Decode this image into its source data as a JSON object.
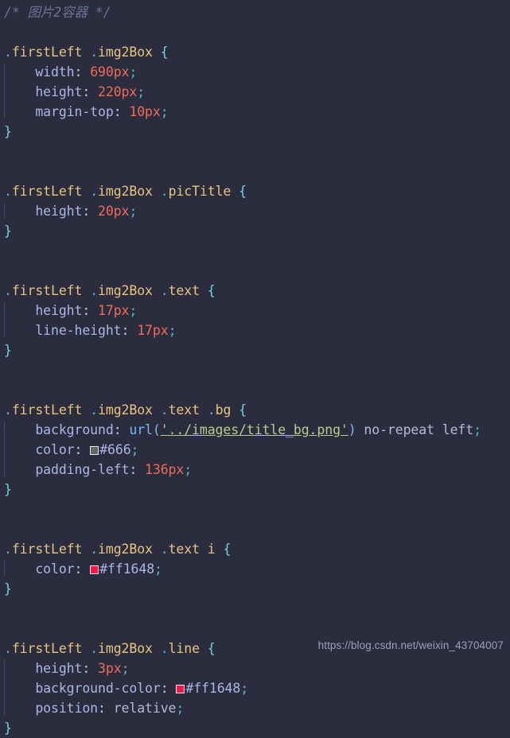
{
  "editor": {
    "theme": {
      "background": "#2b2d3e",
      "comment": "#6b7394",
      "selector": "#e8c47e",
      "property": "#a9b7e8",
      "value": "#ef6b5a",
      "brace": "#6fd3e0",
      "string": "#b7cc8e",
      "keyword": "#b3bad6",
      "indent_guide": "#474b63"
    },
    "language": "css"
  },
  "code": {
    "comment_line": "/* 图片2容器 */",
    "blocks": [
      {
        "selector": {
          "prefix_dot": ".",
          "name": "firstLeft",
          "parts": [
            ".firstLeft",
            ".img2Box"
          ],
          "open_brace": "{"
        },
        "selector_text": ".firstLeft .img2Box {",
        "declarations": [
          {
            "property": "width",
            "value": "690px"
          },
          {
            "property": "height",
            "value": "220px"
          },
          {
            "property": "margin-top",
            "value": "10px"
          }
        ],
        "close_brace": "}"
      },
      {
        "selector_text": ".firstLeft .img2Box .picTitle {",
        "declarations": [
          {
            "property": "height",
            "value": "20px"
          }
        ],
        "close_brace": "}"
      },
      {
        "selector_text": ".firstLeft .img2Box .text {",
        "declarations": [
          {
            "property": "height",
            "value": "17px"
          },
          {
            "property": "line-height",
            "value": "17px"
          }
        ],
        "close_brace": "}"
      },
      {
        "selector_text": ".firstLeft .img2Box .text .bg {",
        "declarations": [
          {
            "property": "background",
            "value": "url('../images/title_bg.png') no-repeat left"
          },
          {
            "property": "color",
            "value": "#666",
            "swatch": "#666666"
          },
          {
            "property": "padding-left",
            "value": "136px"
          }
        ],
        "close_brace": "}"
      },
      {
        "selector_text": ".firstLeft .img2Box .text i {",
        "declarations": [
          {
            "property": "color",
            "value": "#ff1648",
            "swatch": "#ff1648"
          }
        ],
        "close_brace": "}"
      },
      {
        "selector_text": ".firstLeft .img2Box .line {",
        "declarations": [
          {
            "property": "height",
            "value": "3px"
          },
          {
            "property": "background-color",
            "value": "#ff1648",
            "swatch": "#ff1648"
          },
          {
            "property": "position",
            "value": "relative"
          }
        ],
        "close_brace": "}"
      }
    ],
    "tokens": {
      "dot": ".",
      "colon": ":",
      "semicolon": ";",
      "open_brace": "{",
      "close_brace": "}",
      "url_fn": "url(",
      "url_close": ")",
      "url_string": "'../images/title_bg.png'",
      "bg_keywords": "no-repeat left",
      "sel_firstLeft": "firstLeft",
      "sel_img2Box": "img2Box",
      "sel_picTitle": "picTitle",
      "sel_text": "text",
      "sel_bg": "bg",
      "sel_line": "line",
      "sel_i": "i",
      "prop_width": "width",
      "prop_height": "height",
      "prop_margin_top": "margin-top",
      "prop_line_height": "line-height",
      "prop_background": "background",
      "prop_color": "color",
      "prop_padding_left": "padding-left",
      "prop_background_color": "background-color",
      "prop_position": "position",
      "val_690px": "690px",
      "val_220px": "220px",
      "val_10px": "10px",
      "val_20px": "20px",
      "val_17px": "17px",
      "val_136px": "136px",
      "val_3px": "3px",
      "val_666": "#666",
      "val_ff1648": "#ff1648",
      "val_relative": "relative"
    }
  },
  "watermark": {
    "text": "https://blog.csdn.net/weixin_43704007"
  }
}
